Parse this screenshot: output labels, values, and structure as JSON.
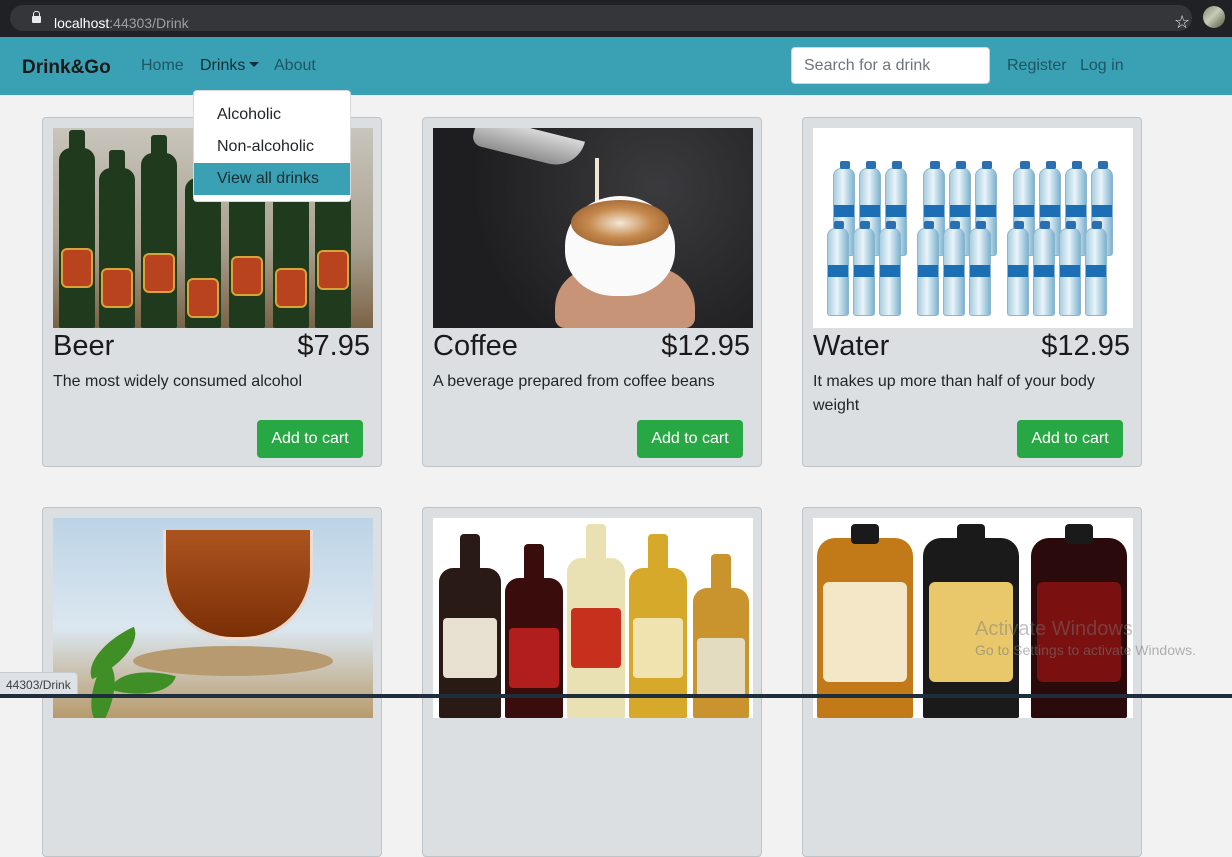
{
  "browser": {
    "url_host": "localhost",
    "url_port_path": ":44303/Drink",
    "status_url": "44303/Drink"
  },
  "navbar": {
    "brand": "Drink&Go",
    "links": [
      "Home",
      "Drinks",
      "About"
    ],
    "search_placeholder": "Search for a drink",
    "register": "Register",
    "login": "Log in",
    "color": "#3aa0b4"
  },
  "dropdown": {
    "items": [
      "Alcoholic",
      "Non-alcoholic",
      "View all drinks"
    ],
    "active_index": 2
  },
  "products": [
    {
      "name": "Beer",
      "price": "$7.95",
      "description": "The most widely consumed alcohol",
      "button": "Add to cart",
      "image": "beer-bottles-image"
    },
    {
      "name": "Coffee",
      "price": "$12.95",
      "description": "A beverage prepared from coffee beans",
      "button": "Add to cart",
      "image": "coffee-cup-image"
    },
    {
      "name": "Water",
      "price": "$12.95",
      "description": "It makes up more than half of your body weight",
      "button": "Add to cart",
      "image": "water-bottles-image"
    },
    {
      "image": "tea-cup-image"
    },
    {
      "image": "rum-bottles-image"
    },
    {
      "image": "captain-morgan-bottles-image"
    }
  ],
  "button_color": "#28a745",
  "watermark": {
    "title": "Activate Windows",
    "subtitle": "Go to Settings to activate Windows."
  }
}
